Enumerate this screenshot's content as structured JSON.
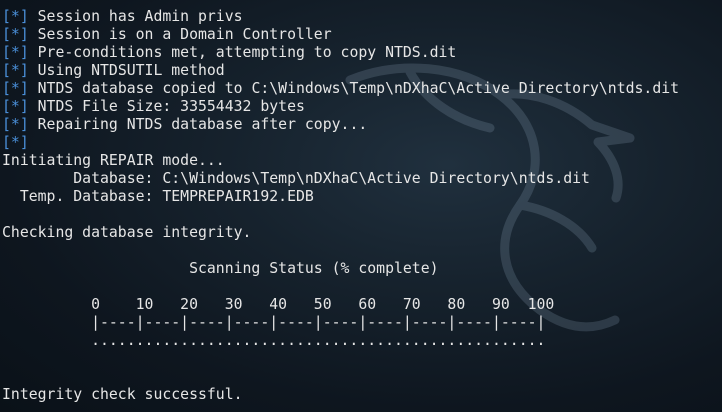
{
  "colors": {
    "background": "#16222d",
    "text": "#e6e6e6",
    "tag": "#4a8fd8"
  },
  "background_logo": "kali-dragon-watermark",
  "lines": [
    {
      "tag": "[*]",
      "text": " Session has Admin privs"
    },
    {
      "tag": "[*]",
      "text": " Session is on a Domain Controller"
    },
    {
      "tag": "[*]",
      "text": " Pre-conditions met, attempting to copy NTDS.dit"
    },
    {
      "tag": "[*]",
      "text": " Using NTDSUTIL method"
    },
    {
      "tag": "[*]",
      "text": " NTDS database copied to C:\\Windows\\Temp\\nDXhaC\\Active Directory\\ntds.dit"
    },
    {
      "tag": "[*]",
      "text": " NTDS File Size: 33554432 bytes"
    },
    {
      "tag": "[*]",
      "text": " Repairing NTDS database after copy..."
    },
    {
      "tag": "[*]",
      "text": ""
    },
    {
      "tag": "",
      "text": "Initiating REPAIR mode..."
    },
    {
      "tag": "",
      "text": "        Database: C:\\Windows\\Temp\\nDXhaC\\Active Directory\\ntds.dit"
    },
    {
      "tag": "",
      "text": "  Temp. Database: TEMPREPAIR192.EDB"
    },
    {
      "tag": "",
      "text": ""
    },
    {
      "tag": "",
      "text": "Checking database integrity."
    },
    {
      "tag": "",
      "text": ""
    },
    {
      "tag": "",
      "text": "                     Scanning Status (% complete)"
    },
    {
      "tag": "",
      "text": ""
    },
    {
      "tag": "",
      "text": "          0    10   20   30   40   50   60   70   80   90  100"
    },
    {
      "tag": "",
      "text": "          |----|----|----|----|----|----|----|----|----|----|"
    },
    {
      "tag": "",
      "text": "          ..................................................."
    },
    {
      "tag": "",
      "text": ""
    },
    {
      "tag": "",
      "text": ""
    },
    {
      "tag": "",
      "text": "Integrity check successful."
    }
  ]
}
